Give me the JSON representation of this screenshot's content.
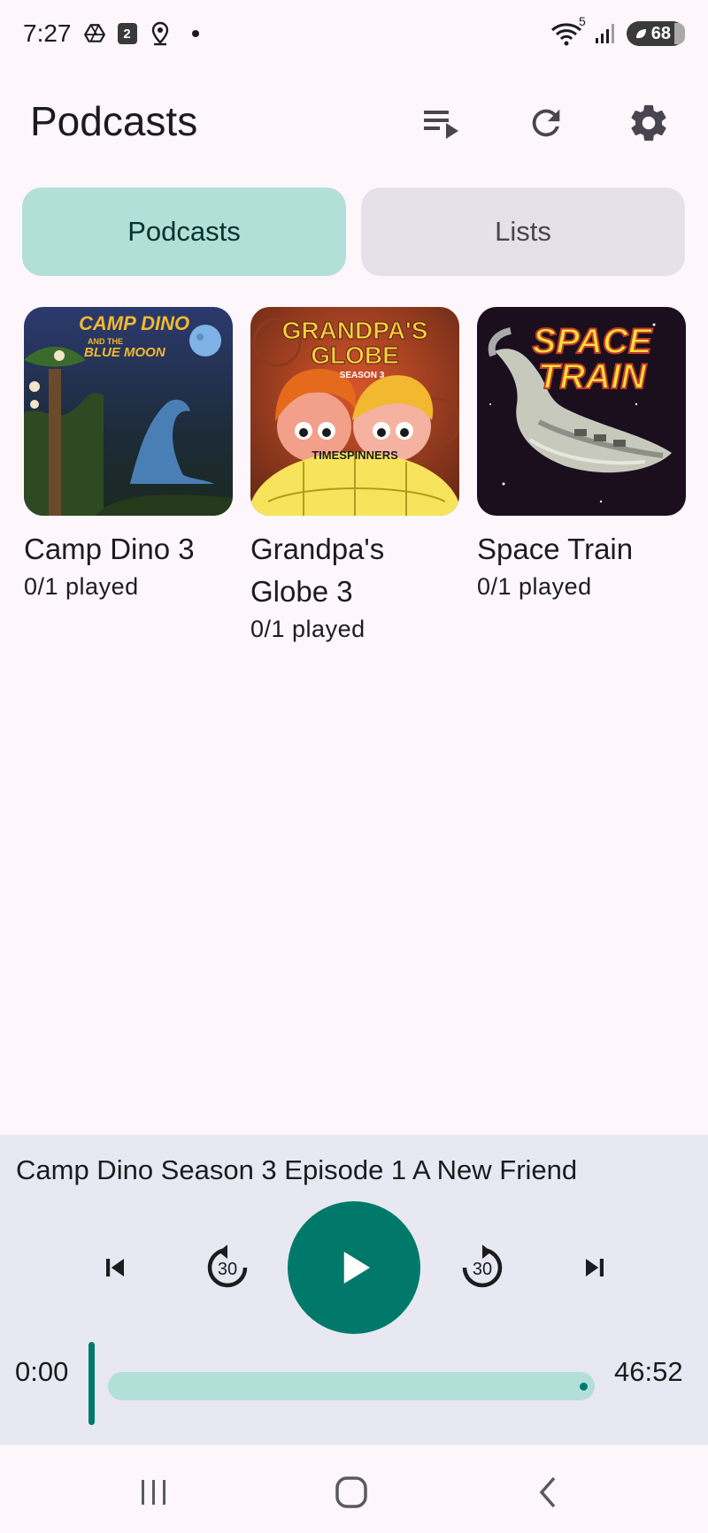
{
  "status_bar": {
    "time": "7:27",
    "calendar_day": "2",
    "wifi_badge": "5",
    "battery": "68"
  },
  "app_bar": {
    "title": "Podcasts",
    "actions": [
      "queue-icon",
      "refresh-icon",
      "settings-icon"
    ]
  },
  "tabs": [
    {
      "label": "Podcasts",
      "selected": true
    },
    {
      "label": "Lists",
      "selected": false
    }
  ],
  "podcasts": [
    {
      "title": "Camp Dino 3",
      "played": "0/1 played",
      "cover_text": [
        "CAMP DINO",
        "AND THE",
        "BLUE MOON"
      ]
    },
    {
      "title": "Grandpa's Globe 3",
      "played": "0/1 played",
      "cover_text": [
        "GRANDPA'S",
        "GLOBE",
        "SEASON 3",
        "TIMESPINNERS"
      ]
    },
    {
      "title": "Space Train",
      "played": "0/1 played",
      "cover_text": [
        "SPACE",
        "TRAIN"
      ]
    }
  ],
  "player": {
    "now_playing": "Camp Dino Season 3 Episode 1 A New Friend",
    "rewind_seconds": "30",
    "forward_seconds": "30",
    "elapsed": "0:00",
    "duration": "46:52",
    "progress": 0
  },
  "colors": {
    "accent": "#00796b",
    "accent_light": "#b2e0d8",
    "background": "#fdf7fc",
    "player_bg": "#e7e8f1"
  }
}
